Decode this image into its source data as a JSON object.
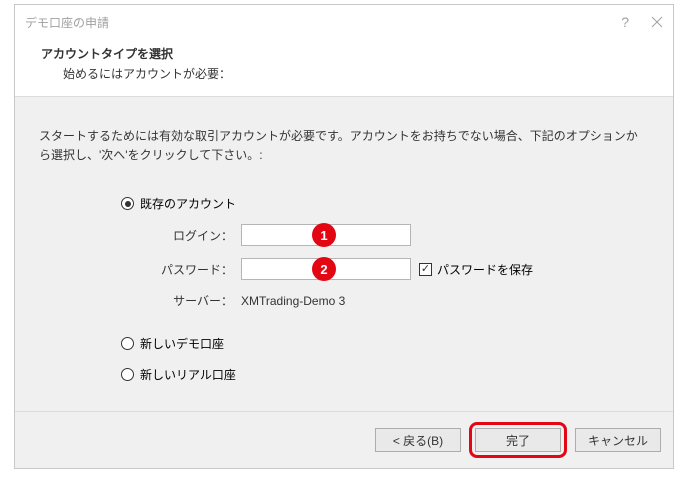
{
  "title": "デモ口座の申請",
  "header": {
    "title": "アカウントタイプを選択",
    "subtitle": "始めるにはアカウントが必要："
  },
  "instruction": "スタートするためには有効な取引アカウントが必要です。アカウントをお持ちでない場合、下記のオプションから選択し、'次へ'をクリックして下さい。:",
  "options": {
    "existing": {
      "label": "既存のアカウント",
      "checked": true,
      "login_label": "ログイン：",
      "login_value": "",
      "password_label": "パスワード：",
      "password_value": "",
      "save_password_label": "パスワードを保存",
      "save_password_checked": true,
      "server_label": "サーバー：",
      "server_value": "XMTrading-Demo 3"
    },
    "new_demo": {
      "label": "新しいデモ口座",
      "checked": false
    },
    "new_real": {
      "label": "新しいリアル口座",
      "checked": false
    }
  },
  "buttons": {
    "back": "< 戻る(B)",
    "finish": "完了",
    "cancel": "キャンセル"
  },
  "annotations": {
    "a1": "1",
    "a2": "2"
  }
}
